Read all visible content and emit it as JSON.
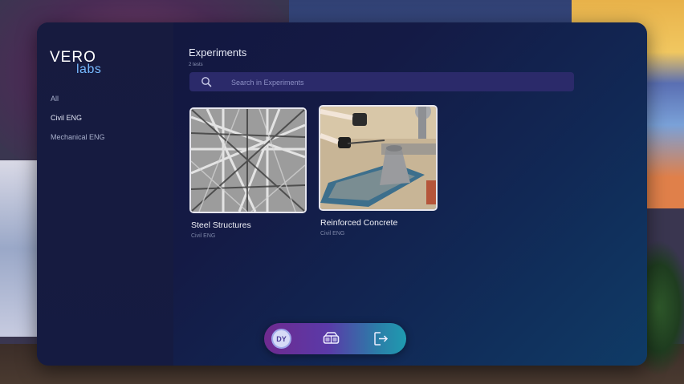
{
  "brand": {
    "line1": "VERO",
    "line2": "labs"
  },
  "sidebar": {
    "items": [
      {
        "label": "All"
      },
      {
        "label": "Civil ENG"
      },
      {
        "label": "Mechanical ENG"
      }
    ]
  },
  "main": {
    "title": "Experiments",
    "count_text": "2 tests",
    "search": {
      "placeholder": "Search in Experiments"
    },
    "experiments": [
      {
        "name": "Steel Structures",
        "category": "Civil ENG",
        "image": "steel-truss-photo"
      },
      {
        "name": "Reinforced Concrete",
        "category": "Civil ENG",
        "image": "concrete-slump-test-photo"
      }
    ]
  },
  "dock": {
    "profile_initials": "DY",
    "icons": [
      "profile-avatar",
      "vr-headset-icon",
      "logout-icon"
    ]
  },
  "colors": {
    "accent": "#76b9ff",
    "panel": "#141a45",
    "search_bg": "#2b2a6a",
    "dock_start": "#6f2a8f",
    "dock_end": "#1f9bb0"
  }
}
